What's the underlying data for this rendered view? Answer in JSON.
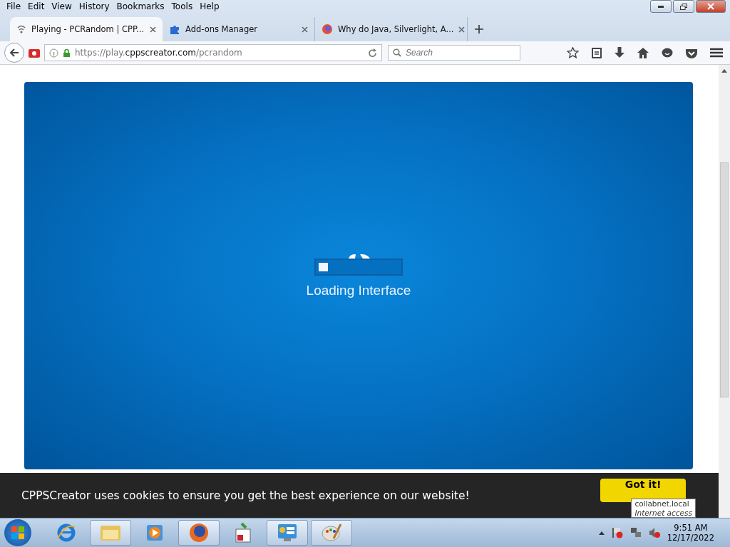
{
  "menu_bar": [
    "File",
    "Edit",
    "View",
    "History",
    "Bookmarks",
    "Tools",
    "Help"
  ],
  "tabs": [
    {
      "label": "Playing - PCRandom | CPP...",
      "selected": true,
      "kind": "wave"
    },
    {
      "label": "Add-ons Manager",
      "selected": false,
      "kind": "puzzle"
    },
    {
      "label": "Why do Java, Silverlight, A...",
      "selected": false,
      "kind": "firefox"
    }
  ],
  "address_bar": {
    "prefix": "https://play.",
    "domain": "cppscreator.com",
    "path": "/pcrandom"
  },
  "search": {
    "placeholder": "Search"
  },
  "game": {
    "loading_text": "Loading Interface",
    "level": 0.12
  },
  "cookie_banner": {
    "message": "CPPSCreator uses cookies to ensure you get the best experience on our website!",
    "button": "Got it!"
  },
  "tooltip": {
    "title": "collabnet.local",
    "subtitle": "Internet access"
  },
  "taskbar": {
    "apps": [
      {
        "kind": "ie",
        "selected": false
      },
      {
        "kind": "explorer",
        "selected": true
      },
      {
        "kind": "media",
        "selected": false
      },
      {
        "kind": "firefox",
        "selected": true
      },
      {
        "kind": "calendar",
        "selected": false
      },
      {
        "kind": "control",
        "selected": true
      },
      {
        "kind": "paint",
        "selected": true
      }
    ],
    "time": "9:51 AM",
    "date": "12/17/2022"
  }
}
